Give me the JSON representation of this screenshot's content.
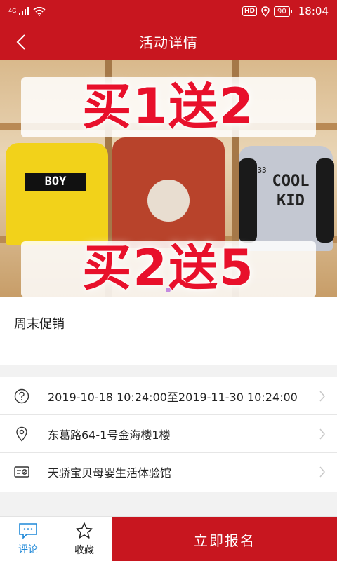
{
  "status_bar": {
    "network": "4G",
    "hd": "HD",
    "battery": "90",
    "time": "18:04"
  },
  "header": {
    "title": "活动详情"
  },
  "banner": {
    "promo_top": "买1送2",
    "promo_bottom": "买2送5",
    "shirt_left_text": "BOY",
    "shirt_right_text_1": "COOL",
    "shirt_right_text_2": "KID",
    "shirt_right_number": "33",
    "colors": {
      "yellow_shirt": "#f2d21a",
      "red_shirt": "#b8432b",
      "grey_shirt": "#c4c8d2"
    }
  },
  "event": {
    "name": "周末促销",
    "time": "2019-10-18 10:24:00至2019-11-30 10:24:00",
    "address": "东葛路64-1号金海楼1楼",
    "organizer": "天骄宝贝母婴生活体验馆"
  },
  "bottom_bar": {
    "comment_label": "评论",
    "favorite_label": "收藏",
    "signup_label": "立即报名"
  },
  "colors": {
    "brand": "#c8161f",
    "comment_accent": "#1e88d8"
  }
}
